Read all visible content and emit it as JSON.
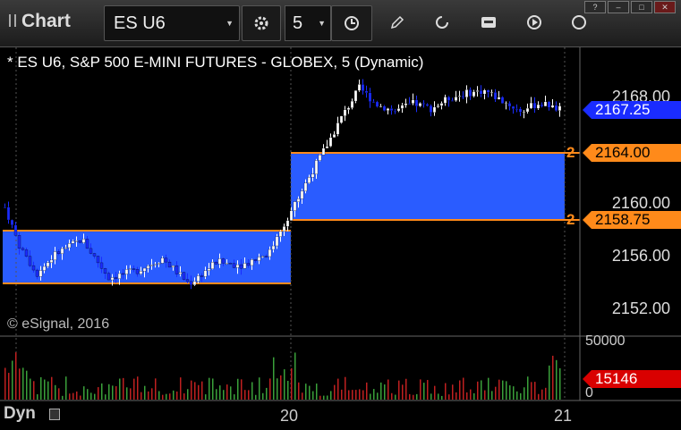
{
  "app": {
    "title": "Chart"
  },
  "toolbar": {
    "symbol": "ES U6",
    "interval": "5"
  },
  "chart": {
    "title": "* ES U6, S&P 500 E-MINI FUTURES - GLOBEX, 5 (Dynamic)",
    "copyright": "© eSignal, 2016",
    "price_axis": [
      "2168.00",
      "2164.00",
      "2160.00",
      "2156.00",
      "2152.00"
    ],
    "last_price": "2167.25",
    "zone_upper_price": "2164.00",
    "zone_lower_price": "2158.75",
    "zone_badge": "2",
    "volume_axis_top": "50000",
    "volume_axis_bottom": "0",
    "last_volume": "15146",
    "date_labels": [
      "20",
      "21"
    ],
    "mode_label": "Dyn",
    "colors": {
      "up": "#ffffff",
      "down": "#1a2cff",
      "zone": "#2a5cff",
      "zone_line": "#ff8a1a",
      "last_tag": "#1a2cff",
      "volume_tag": "#d90000"
    }
  }
}
